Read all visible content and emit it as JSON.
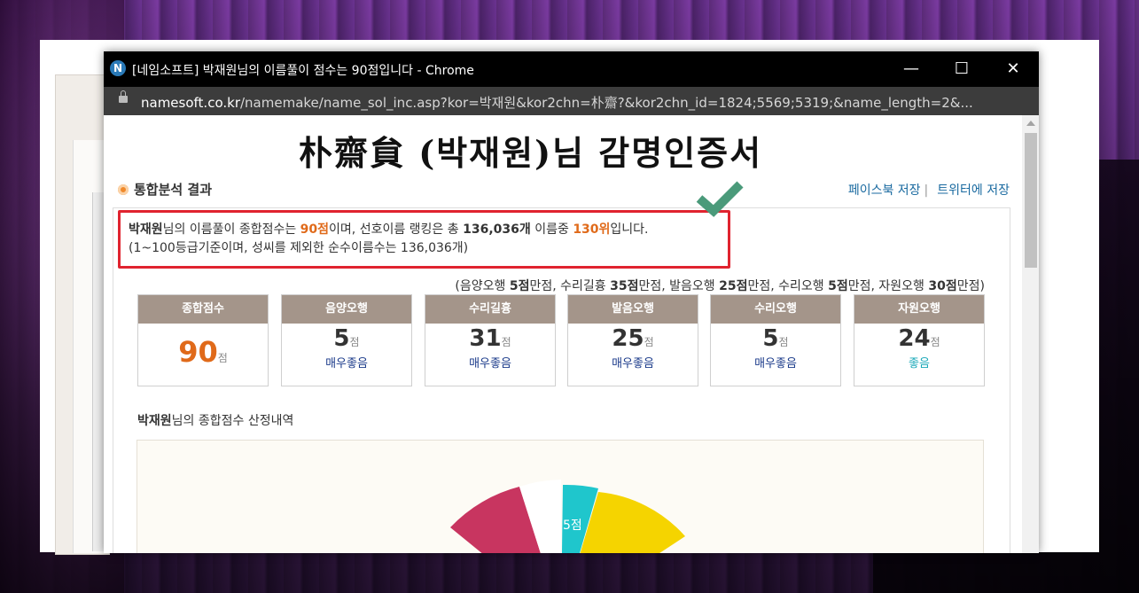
{
  "window": {
    "title": "[네임소프트] 박재원님의 이름풀이 점수는 90점입니다 - Chrome",
    "icon_letter": "N",
    "controls": {
      "minimize": "—",
      "maximize": "☐",
      "close": "✕"
    }
  },
  "address": {
    "domain": "namesoft.co.kr",
    "path": "/namemake/name_sol_inc.asp?kor=박재원&kor2chn=朴齋?&kor2chn_id=1824;5569;5319;&name_length=2&..."
  },
  "page": {
    "cert_title": "朴齋貟 (박재원)님 감명인증서",
    "section_title": "통합분석 결과",
    "share": {
      "facebook": "페이스북 저장",
      "separator": "|",
      "twitter": "트위터에 저장"
    },
    "summary": {
      "name": "박재원",
      "line1_a": "님의 이름풀이 종합점수는 ",
      "total_score": "90점",
      "line1_b": "이며, 선호이름 랭킹은 총 ",
      "total_names": "136,036개",
      "line1_c": " 이름중 ",
      "rank": "130위",
      "line1_d": "입니다.",
      "line2": "(1~100등급기준이며, 성씨를 제외한 순수이름수는 136,036개)"
    },
    "max_note": {
      "p1": "(음양오행 ",
      "v1": "5점",
      "p2": "만점, 수리길흉 ",
      "v2": "35점",
      "p3": "만점, 발음오행 ",
      "v3": "25점",
      "p4": "만점, 수리오행 ",
      "v4": "5점",
      "p5": "만점, 자원오행 ",
      "v5": "30점",
      "p6": "만점)"
    },
    "cards": [
      {
        "label": "종합점수",
        "score": "90",
        "unit": "점",
        "grade": ""
      },
      {
        "label": "음양오행",
        "score": "5",
        "unit": "점",
        "grade": "매우좋음"
      },
      {
        "label": "수리길흉",
        "score": "31",
        "unit": "점",
        "grade": "매우좋음"
      },
      {
        "label": "발음오행",
        "score": "25",
        "unit": "점",
        "grade": "매우좋음"
      },
      {
        "label": "수리오행",
        "score": "5",
        "unit": "점",
        "grade": "매우좋음"
      },
      {
        "label": "자원오행",
        "score": "24",
        "unit": "점",
        "grade": "좋음"
      }
    ],
    "detail": {
      "name": "박재원",
      "title": "님의 종합점수 산정내역"
    },
    "pie_label": "5점"
  },
  "colors": {
    "highlight_red": "#e0232f",
    "score_orange": "#e06a1a",
    "card_header": "#a4958a",
    "check_green": "#4a9a7a"
  }
}
